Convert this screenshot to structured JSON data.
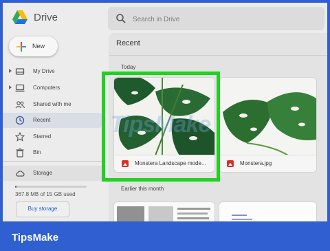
{
  "app": {
    "name": "Drive",
    "logo_colors": [
      "#1a73e8",
      "#34a853",
      "#fbbc04"
    ]
  },
  "search": {
    "placeholder": "Search in Drive"
  },
  "sidebar": {
    "new_label": "New",
    "items": [
      {
        "label": "My Drive",
        "icon": "my-drive-icon",
        "expandable": true
      },
      {
        "label": "Computers",
        "icon": "computer-icon",
        "expandable": true
      },
      {
        "label": "Shared with me",
        "icon": "people-icon",
        "expandable": false
      },
      {
        "label": "Recent",
        "icon": "clock-icon",
        "expandable": false,
        "active": true
      },
      {
        "label": "Starred",
        "icon": "star-icon",
        "expandable": false
      },
      {
        "label": "Bin",
        "icon": "trash-icon",
        "expandable": false
      }
    ],
    "storage": {
      "label": "Storage",
      "usage_text": "367.8 MB of 15 GB used",
      "used_fraction": 0.024,
      "buy_label": "Buy storage"
    }
  },
  "main": {
    "heading": "Recent",
    "sections": [
      {
        "label": "Today",
        "files": [
          {
            "name": "Monstera Landscape mode...",
            "selected": true
          },
          {
            "name": "Monstera.jpg",
            "selected": false
          }
        ]
      },
      {
        "label": "Earlier this month",
        "files": [
          {
            "name": ""
          },
          {
            "name": ""
          }
        ]
      }
    ]
  },
  "watermark": "TipsMake",
  "brand": "TipsMake",
  "colors": {
    "highlight": "#22d022",
    "frame": "#2f5fd0",
    "accent": "#1a73e8"
  }
}
